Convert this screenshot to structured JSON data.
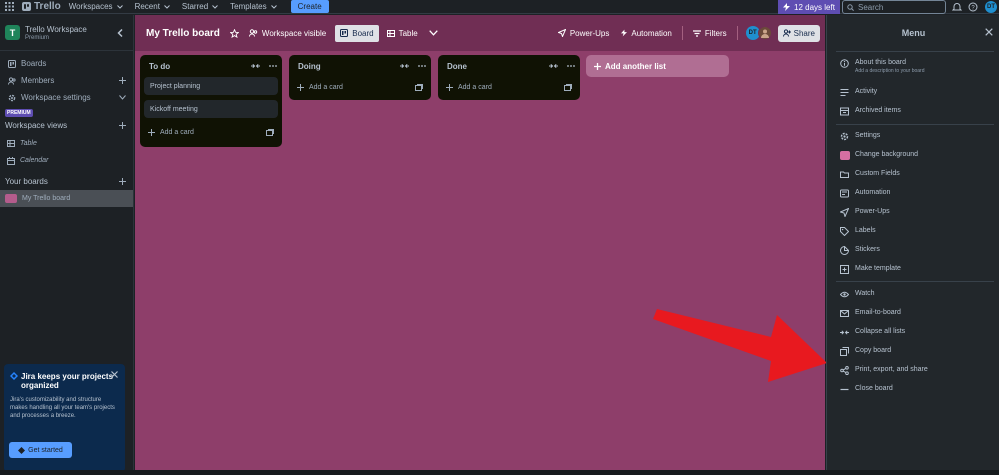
{
  "topbar": {
    "logo": "Trello",
    "nav": [
      "Workspaces",
      "Recent",
      "Starred",
      "Templates"
    ],
    "create": "Create",
    "trial": "12 days left",
    "search_placeholder": "Search",
    "avatar": "DT"
  },
  "sidebar": {
    "workspace_name": "Trello Workspace",
    "workspace_plan": "Premium",
    "items": [
      "Boards",
      "Members",
      "Workspace settings"
    ],
    "premium_badge": "PREMIUM",
    "views_title": "Workspace views",
    "views": [
      "Table",
      "Calendar"
    ],
    "boards_title": "Your boards",
    "boards": [
      "My Trello board"
    ],
    "promo": {
      "title": "Jira keeps your projects organized",
      "body": "Jira's customizability and structure makes handling all your team's projects and processes a breeze.",
      "button": "Get started"
    }
  },
  "board": {
    "title": "My Trello board",
    "visibility": "Workspace visible",
    "views": [
      "Board",
      "Table"
    ],
    "actions": [
      "Power-Ups",
      "Automation",
      "Filters"
    ],
    "share": "Share",
    "avatar": "DT",
    "lists": [
      {
        "title": "To do",
        "cards": [
          "Project planning",
          "Kickoff meeting"
        ],
        "add": "Add a card"
      },
      {
        "title": "Doing",
        "cards": [],
        "add": "Add a card"
      },
      {
        "title": "Done",
        "cards": [],
        "add": "Add a card"
      }
    ],
    "add_list": "Add another list"
  },
  "menu": {
    "title": "Menu",
    "about": {
      "label": "About this board",
      "sub": "Add a description to your board"
    },
    "group1": [
      "Activity",
      "Archived items"
    ],
    "group2": [
      "Settings",
      "Change background",
      "Custom Fields",
      "Automation",
      "Power-Ups",
      "Labels",
      "Stickers",
      "Make template"
    ],
    "group3": [
      "Watch",
      "Email-to-board",
      "Collapse all lists",
      "Copy board",
      "Print, export, and share",
      "Close board"
    ]
  },
  "colors": {
    "board_bg": "#8e3e6a",
    "accent": "#579dff",
    "arrow": "#e8191f"
  }
}
